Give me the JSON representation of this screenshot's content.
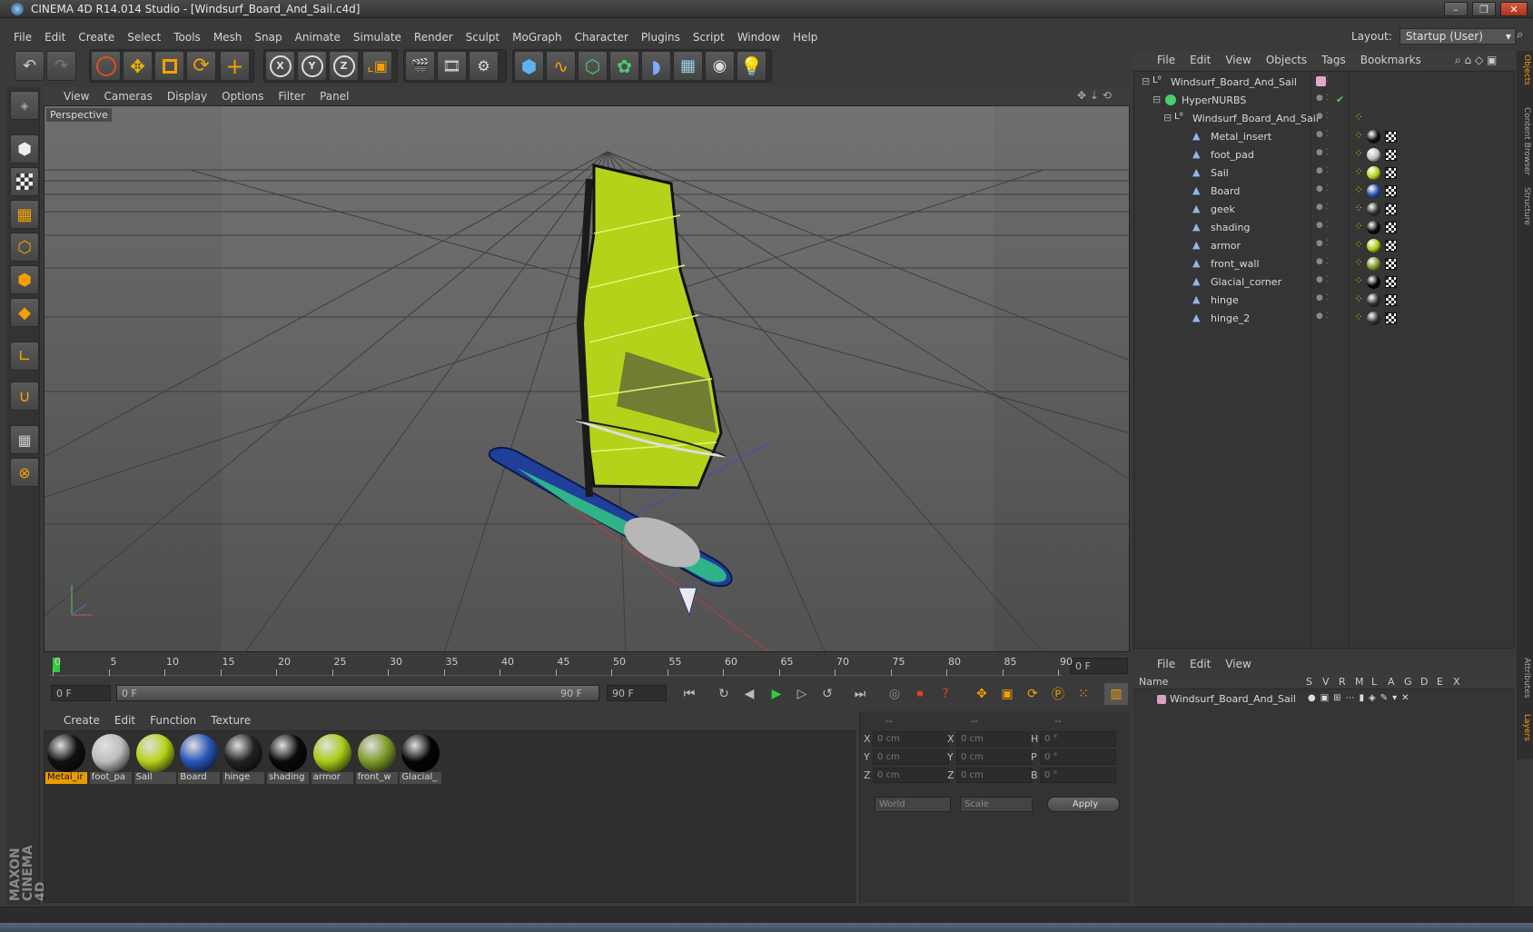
{
  "window": {
    "title": "CINEMA 4D R14.014 Studio - [Windsurf_Board_And_Sail.c4d]"
  },
  "menu": [
    "File",
    "Edit",
    "Create",
    "Select",
    "Tools",
    "Mesh",
    "Snap",
    "Animate",
    "Simulate",
    "Render",
    "Sculpt",
    "MoGraph",
    "Character",
    "Plugins",
    "Script",
    "Window",
    "Help"
  ],
  "layout": {
    "label": "Layout:",
    "value": "Startup (User)"
  },
  "viewport": {
    "menu": [
      "View",
      "Cameras",
      "Display",
      "Options",
      "Filter",
      "Panel"
    ],
    "label": "Perspective"
  },
  "timeline": {
    "ticks": [
      "0",
      "5",
      "10",
      "15",
      "20",
      "25",
      "30",
      "35",
      "40",
      "45",
      "50",
      "55",
      "60",
      "65",
      "70",
      "75",
      "80",
      "85",
      "90"
    ],
    "current_frame": "0 F",
    "start_field": "0 F",
    "range_start": "0 F",
    "range_end": "90 F",
    "end_field": "90 F"
  },
  "materials": {
    "menu": [
      "Create",
      "Edit",
      "Function",
      "Texture"
    ],
    "items": [
      {
        "name": "Metal_ir",
        "color": "#111"
      },
      {
        "name": "foot_pa",
        "color": "#bdbdbd"
      },
      {
        "name": "Sail",
        "color": "#b8d21a"
      },
      {
        "name": "Board",
        "color": "#2956b8"
      },
      {
        "name": "hinge",
        "color": "#222"
      },
      {
        "name": "shading",
        "color": "#0a0a0a"
      },
      {
        "name": "armor",
        "color": "#a8cc18"
      },
      {
        "name": "front_w",
        "color": "#7f9a2a"
      },
      {
        "name": "Glacial_",
        "color": "#050505"
      }
    ]
  },
  "coords": {
    "headers": [
      "--",
      "--",
      "--"
    ],
    "rows": [
      {
        "a": "X",
        "av": "0 cm",
        "b": "X",
        "bv": "0 cm",
        "c": "H",
        "cv": "0 °"
      },
      {
        "a": "Y",
        "av": "0 cm",
        "b": "Y",
        "bv": "0 cm",
        "c": "P",
        "cv": "0 °"
      },
      {
        "a": "Z",
        "av": "0 cm",
        "b": "Z",
        "bv": "0 cm",
        "c": "B",
        "cv": "0 °"
      }
    ],
    "world": "World",
    "scale": "Scale",
    "apply": "Apply"
  },
  "objects": {
    "menu": [
      "File",
      "Edit",
      "View",
      "Objects",
      "Tags",
      "Bookmarks"
    ],
    "tree": [
      {
        "name": "Windsurf_Board_And_Sail",
        "depth": 0
      },
      {
        "name": "HyperNURBS",
        "depth": 1
      },
      {
        "name": "Windsurf_Board_And_Sail",
        "depth": 2
      },
      {
        "name": "Metal_insert",
        "depth": 3,
        "mat": "#111"
      },
      {
        "name": "foot_pad",
        "depth": 3,
        "mat": "#c0c0c0"
      },
      {
        "name": "Sail",
        "depth": 3,
        "mat": "#b8d21a"
      },
      {
        "name": "Board",
        "depth": 3,
        "mat": "#2956b8"
      },
      {
        "name": "geek",
        "depth": 3,
        "mat": "#333"
      },
      {
        "name": "shading",
        "depth": 3,
        "mat": "#0a0a0a"
      },
      {
        "name": "armor",
        "depth": 3,
        "mat": "#a8cc18"
      },
      {
        "name": "front_wall",
        "depth": 3,
        "mat": "#7f9a2a"
      },
      {
        "name": "Glacial_corner",
        "depth": 3,
        "mat": "#050505"
      },
      {
        "name": "hinge",
        "depth": 3,
        "mat": "#333"
      },
      {
        "name": "hinge_2",
        "depth": 3,
        "mat": "#333"
      }
    ]
  },
  "layers": {
    "menu": [
      "File",
      "Edit",
      "View"
    ],
    "header": {
      "name": "Name",
      "cols": [
        "S",
        "V",
        "R",
        "M",
        "L",
        "A",
        "G",
        "D",
        "E",
        "X"
      ]
    },
    "rows": [
      {
        "name": "Windsurf_Board_And_Sail"
      }
    ]
  },
  "side_tabs": [
    "Objects",
    "Content Browser",
    "Structure",
    "Attributes",
    "Layers"
  ],
  "brand": "MAXON CINEMA 4D"
}
